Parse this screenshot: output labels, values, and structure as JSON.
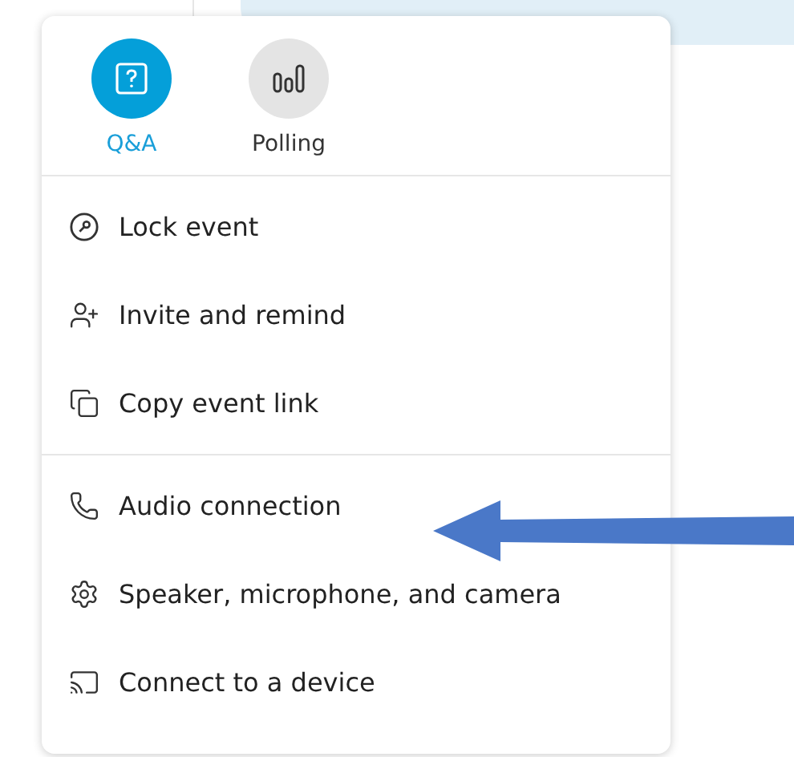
{
  "quick_actions": [
    {
      "label": "Q&A",
      "kind": "qa",
      "selected": true
    },
    {
      "label": "Polling",
      "kind": "polling",
      "selected": false
    }
  ],
  "menu_sections": [
    [
      {
        "label": "Lock event",
        "kind": "lock"
      },
      {
        "label": "Invite and remind",
        "kind": "invite"
      },
      {
        "label": "Copy event link",
        "kind": "copy"
      }
    ],
    [
      {
        "label": "Audio connection",
        "kind": "audio"
      },
      {
        "label": "Speaker, microphone, and camera",
        "kind": "settings"
      },
      {
        "label": "Connect to a device",
        "kind": "cast"
      }
    ]
  ]
}
